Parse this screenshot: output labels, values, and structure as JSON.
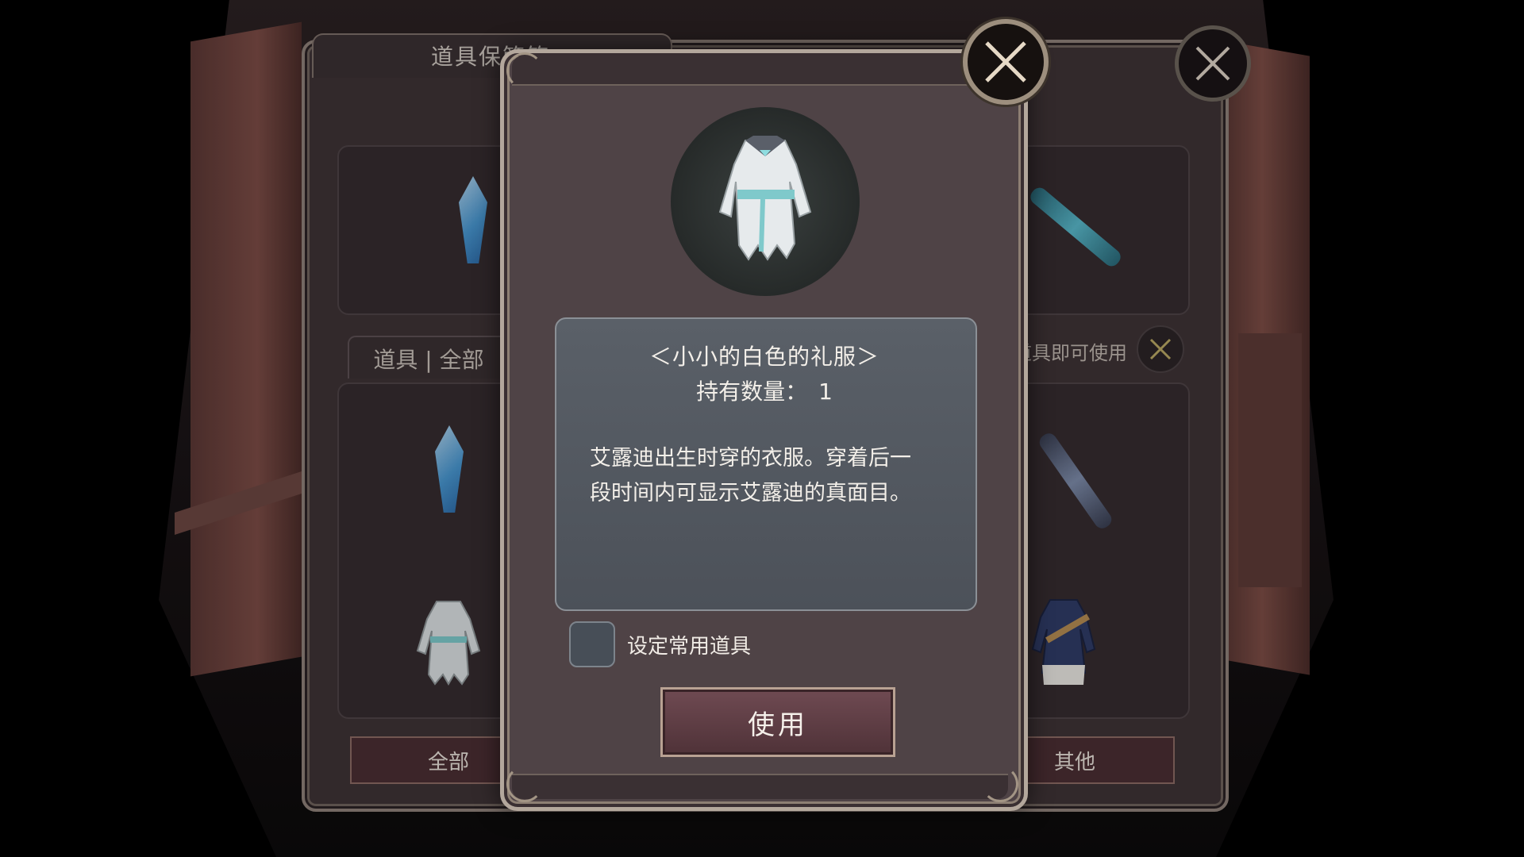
{
  "inventory": {
    "title": "道具保管箱",
    "filter_label": "道具 | 全部",
    "hint": "击道具即可使用",
    "tabs": {
      "all": "全部",
      "other": "其他"
    }
  },
  "modal": {
    "item_name": "＜小小的白色的礼服＞",
    "quantity_label": "持有数量：",
    "quantity_value": "1",
    "description_line1": "艾露迪出生时穿的衣服。穿着后一",
    "description_line2": "段时间内可显示艾露迪的真面目。",
    "favorite_label": "设定常用道具",
    "favorite_checked": false,
    "use_button": "使用"
  },
  "icons": {
    "close": "close-icon",
    "item": "white-dress-icon",
    "crystal": "crystal-icon",
    "weapon": "weapon-icon"
  }
}
